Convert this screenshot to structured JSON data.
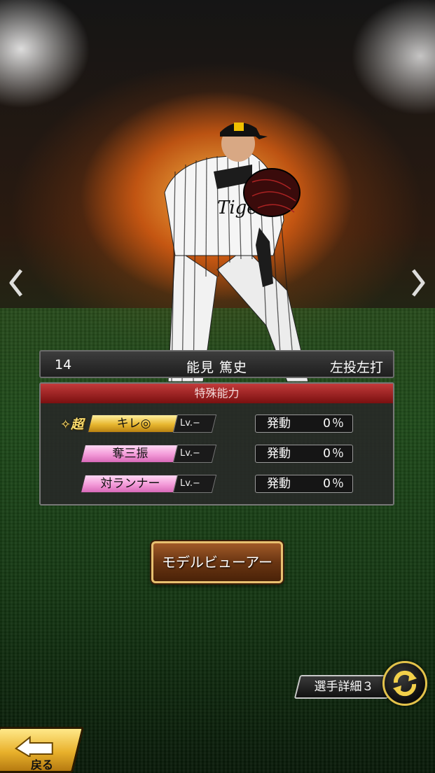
{
  "player": {
    "uniform_number": "14",
    "name": "能見 篤史",
    "handedness": "左投左打"
  },
  "abilities": {
    "header": "特殊能力",
    "super_mark": "✧超",
    "items": [
      {
        "label": "キレ◎",
        "level": "Lv.−",
        "rate_label": "発動",
        "rate": "0％",
        "color": "#e8b730"
      },
      {
        "label": "奪三振",
        "level": "Lv.−",
        "rate_label": "発動",
        "rate": "0％",
        "color": "#f39ad8"
      },
      {
        "label": "対ランナー",
        "level": "Lv.−",
        "rate_label": "発動",
        "rate": "0％",
        "color": "#f39ad8"
      }
    ]
  },
  "buttons": {
    "model_viewer": "モデルビューアー",
    "player_detail": "選手詳細３",
    "back": "戻る"
  },
  "icons": {
    "prev": "chevron-left-icon",
    "next": "chevron-right-icon",
    "swap": "swap-arrows-icon",
    "back": "back-arrow-icon"
  }
}
